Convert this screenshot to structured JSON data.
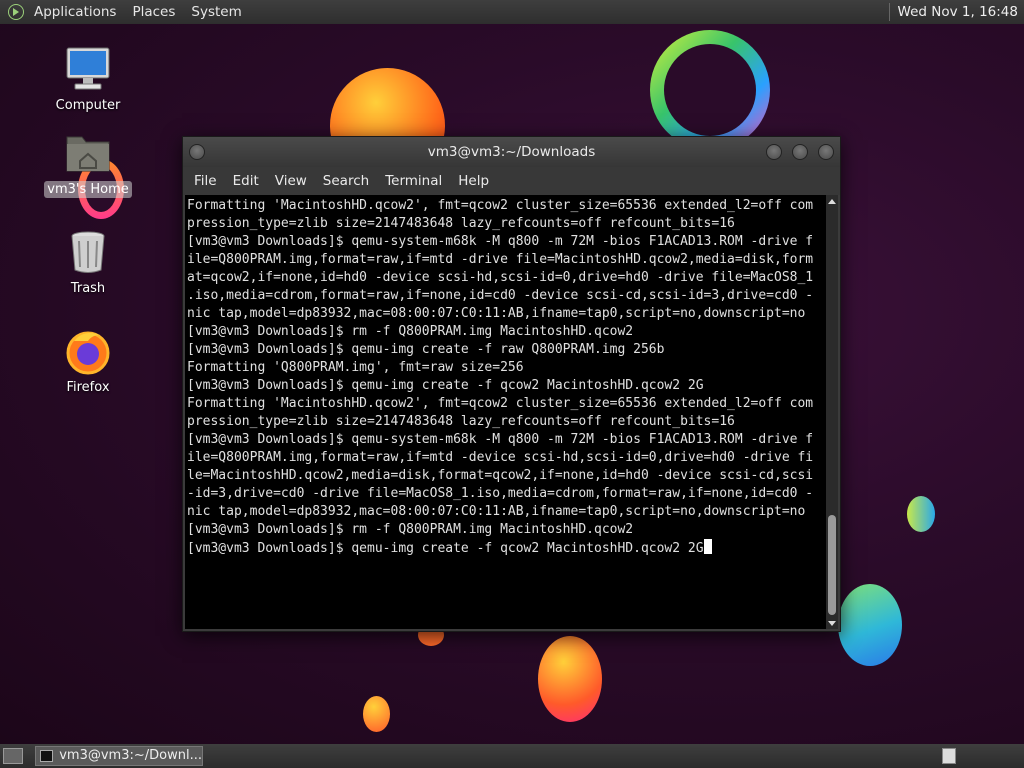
{
  "top_panel": {
    "menus": [
      "Applications",
      "Places",
      "System"
    ],
    "clock": "Wed Nov 1, 16:48"
  },
  "desktop_icons": [
    {
      "label": "Computer",
      "icon": "computer-icon"
    },
    {
      "label": "vm3's Home",
      "icon": "home-folder-icon",
      "selected": true
    },
    {
      "label": "Trash",
      "icon": "trash-icon"
    },
    {
      "label": "Firefox",
      "icon": "firefox-icon"
    }
  ],
  "terminal": {
    "title": "vm3@vm3:~/Downloads",
    "menu": [
      "File",
      "Edit",
      "View",
      "Search",
      "Terminal",
      "Help"
    ],
    "lines": [
      "Formatting 'MacintoshHD.qcow2', fmt=qcow2 cluster_size=65536 extended_l2=off com",
      "pression_type=zlib size=2147483648 lazy_refcounts=off refcount_bits=16",
      "[vm3@vm3 Downloads]$ qemu-system-m68k -M q800 -m 72M -bios F1ACAD13.ROM -drive f",
      "ile=Q800PRAM.img,format=raw,if=mtd -drive file=MacintoshHD.qcow2,media=disk,form",
      "at=qcow2,if=none,id=hd0 -device scsi-hd,scsi-id=0,drive=hd0 -drive file=MacOS8_1",
      ".iso,media=cdrom,format=raw,if=none,id=cd0 -device scsi-cd,scsi-id=3,drive=cd0 -",
      "nic tap,model=dp83932,mac=08:00:07:C0:11:AB,ifname=tap0,script=no,downscript=no",
      "[vm3@vm3 Downloads]$ rm -f Q800PRAM.img MacintoshHD.qcow2",
      "[vm3@vm3 Downloads]$ qemu-img create -f raw Q800PRAM.img 256b",
      "Formatting 'Q800PRAM.img', fmt=raw size=256",
      "[vm3@vm3 Downloads]$ qemu-img create -f qcow2 MacintoshHD.qcow2 2G",
      "Formatting 'MacintoshHD.qcow2', fmt=qcow2 cluster_size=65536 extended_l2=off com",
      "pression_type=zlib size=2147483648 lazy_refcounts=off refcount_bits=16",
      "[vm3@vm3 Downloads]$ qemu-system-m68k -M q800 -m 72M -bios F1ACAD13.ROM -drive f",
      "ile=Q800PRAM.img,format=raw,if=mtd -device scsi-hd,scsi-id=0,drive=hd0 -drive fi",
      "le=MacintoshHD.qcow2,media=disk,format=qcow2,if=none,id=hd0 -device scsi-cd,scsi",
      "-id=3,drive=cd0 -drive file=MacOS8_1.iso,media=cdrom,format=raw,if=none,id=cd0 -",
      "nic tap,model=dp83932,mac=08:00:07:C0:11:AB,ifname=tap0,script=no,downscript=no",
      "[vm3@vm3 Downloads]$ rm -f Q800PRAM.img MacintoshHD.qcow2"
    ],
    "prompt_line": "[vm3@vm3 Downloads]$ qemu-img create -f qcow2 MacintoshHD.qcow2 2G"
  },
  "bottom_panel": {
    "task_label": "vm3@vm3:~/Downl..."
  },
  "colors": {
    "terminal_bg": "#000000",
    "terminal_fg": "#e0e0e0",
    "panel_bg": "#383838"
  }
}
